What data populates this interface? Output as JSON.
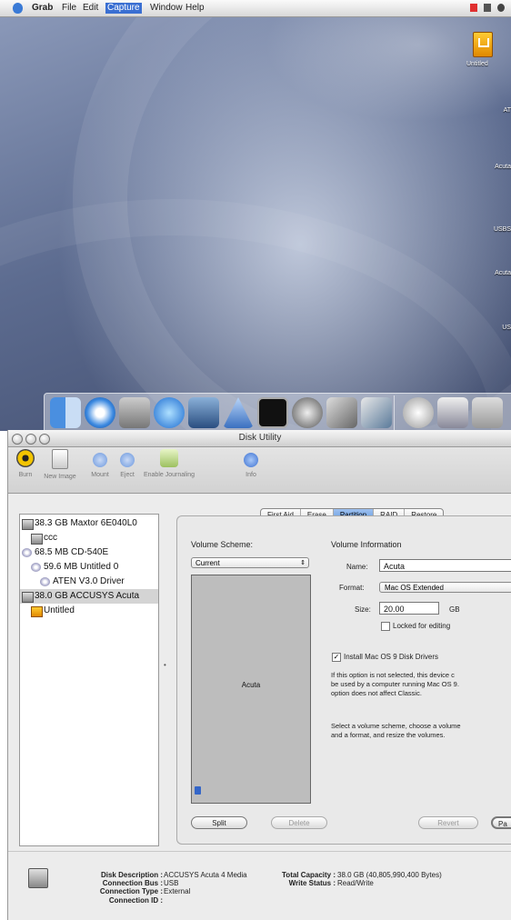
{
  "menubar": {
    "app": "Grab",
    "items": [
      "File",
      "Edit",
      "Capture",
      "Window",
      "Help"
    ]
  },
  "desktop": {
    "volume_label": "Untitled",
    "side_labels": [
      "AT",
      "Acuta",
      "USBS",
      "Acuta",
      "US"
    ]
  },
  "dock": {
    "icons": [
      "finder-icon",
      "safari-icon",
      "iphoto-icon",
      "network-icon",
      "disk-utility-icon",
      "transmit-icon",
      "terminal-icon",
      "system-prefs-icon",
      "preview-icon",
      "itunes-icon",
      "mail-icon",
      "monitor-icon"
    ]
  },
  "window": {
    "title": "Disk Utility",
    "toolbar": [
      {
        "name": "burn",
        "label": "Burn"
      },
      {
        "name": "new-image",
        "label": "New Image"
      },
      {
        "name": "mount",
        "label": "Mount"
      },
      {
        "name": "eject",
        "label": "Eject"
      },
      {
        "name": "enable-journaling",
        "label": "Enable Journaling"
      },
      {
        "name": "info",
        "label": "Info"
      }
    ],
    "disks": [
      {
        "label": "38.3 GB Maxtor 6E040L0",
        "indent": 0,
        "kind": "disk",
        "selected": false
      },
      {
        "label": "ccc",
        "indent": 1,
        "kind": "volume",
        "selected": false
      },
      {
        "label": "68.5 MB CD-540E",
        "indent": 0,
        "kind": "cd",
        "selected": false
      },
      {
        "label": "59.6 MB Untitled 0",
        "indent": 1,
        "kind": "cd",
        "selected": false
      },
      {
        "label": "ATEN V3.0 Driver",
        "indent": 2,
        "kind": "cd",
        "selected": false
      },
      {
        "label": "38.0 GB ACCUSYS Acuta",
        "indent": 0,
        "kind": "disk",
        "selected": true
      },
      {
        "label": "Untitled",
        "indent": 1,
        "kind": "usb",
        "selected": false
      }
    ],
    "tabs": [
      {
        "label": "First Aid",
        "selected": false
      },
      {
        "label": "Erase",
        "selected": false
      },
      {
        "label": "Partition",
        "selected": true
      },
      {
        "label": "RAID",
        "selected": false
      },
      {
        "label": "Restore",
        "selected": false
      }
    ],
    "partition": {
      "scheme_heading": "Volume Scheme:",
      "scheme_value": "Current",
      "volume_name": "Acuta",
      "info_heading": "Volume Information",
      "name_label": "Name:",
      "name_value": "Acuta",
      "format_label": "Format:",
      "format_value": "Mac OS Extended",
      "size_label": "Size:",
      "size_value": "20.00",
      "size_unit": "GB",
      "locked_label": "Locked for editing",
      "locked_checked": false,
      "os9_label": "Install Mac OS 9 Disk Drivers",
      "os9_checked": true,
      "help1": [
        "If this option is not selected, this device c",
        "be used by a computer running Mac OS 9.",
        "option does not affect Classic."
      ],
      "help2": [
        "Select a volume scheme, choose a volume",
        "and a format, and resize the volumes."
      ],
      "split": "Split",
      "delete": "Delete",
      "revert": "Revert",
      "partition_btn": "Pa"
    },
    "info": {
      "disk_description_key": "Disk Description :",
      "disk_description": "ACCUSYS Acuta 4 Media",
      "connection_bus_key": "Connection Bus :",
      "connection_bus": "USB",
      "connection_type_key": "Connection Type :",
      "connection_type": "External",
      "connection_id_key": "Connection ID :",
      "connection_id": "",
      "total_capacity_key": "Total Capacity :",
      "total_capacity": "38.0 GB (40,805,990,400 Bytes)",
      "write_status_key": "Write Status :",
      "write_status": "Read/Write"
    }
  }
}
